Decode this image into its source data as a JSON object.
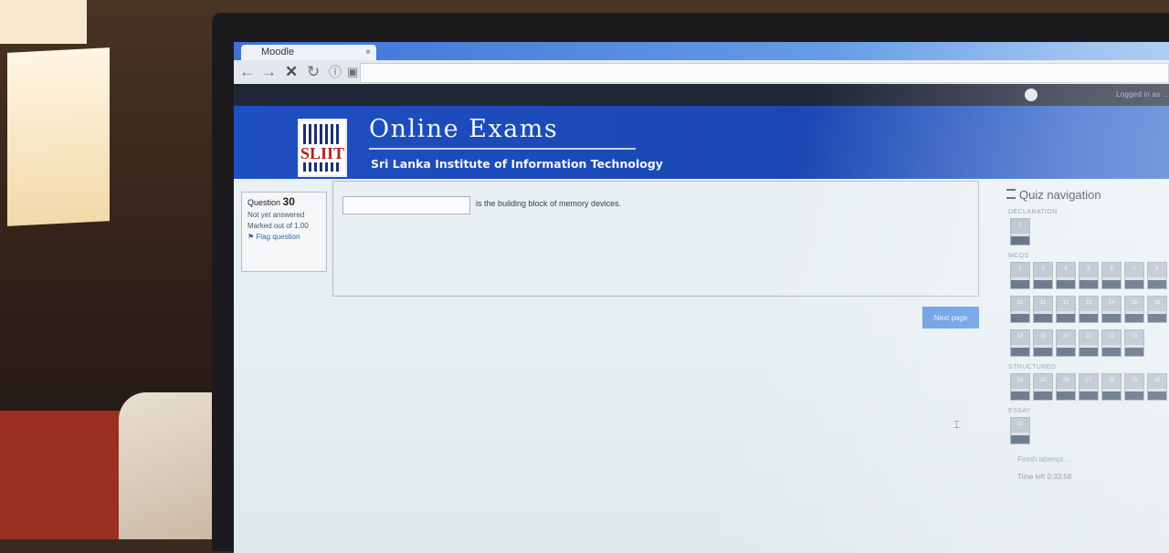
{
  "browser": {
    "tab_title": "Moodle",
    "tab_close": "×"
  },
  "user_bar": {
    "user_text": "Logged in as ..."
  },
  "header": {
    "title": "Online Exams",
    "subtitle": "Sri Lanka Institute of Information Technology",
    "logo_text": "SLIIT"
  },
  "question": {
    "number_label": "Question",
    "number": "30",
    "status": "Not yet answered",
    "marks": "Marked out of 1.00",
    "flag_label": "Flag question",
    "text": "is the building block of memory devices.",
    "answer_value": ""
  },
  "actions": {
    "next_label": "Next page"
  },
  "quiz_nav": {
    "title": "Quiz navigation",
    "sections": [
      {
        "label": "DECLARATION",
        "rows": [
          [
            "1"
          ]
        ]
      },
      {
        "label": "MCQS",
        "rows": [
          [
            "2",
            "3",
            "4",
            "5",
            "6",
            "7",
            "8"
          ],
          [
            "10",
            "11",
            "12",
            "13",
            "14",
            "15",
            "16"
          ],
          [
            "18",
            "19",
            "20",
            "21",
            "22",
            "23"
          ]
        ]
      },
      {
        "label": "STRUCTURED",
        "rows": [
          [
            "24",
            "25",
            "26",
            "27",
            "28",
            "29",
            "30"
          ]
        ]
      },
      {
        "label": "ESSAY",
        "rows": [
          [
            "31"
          ]
        ]
      }
    ],
    "finish_label": "Finish attempt ...",
    "time_left_label": "Time left",
    "time_left": "0:33:58"
  },
  "colors": {
    "banner_blue": "#1e4fc2",
    "tab_blue": "#3d71d6",
    "button_blue": "#5b95e2"
  }
}
